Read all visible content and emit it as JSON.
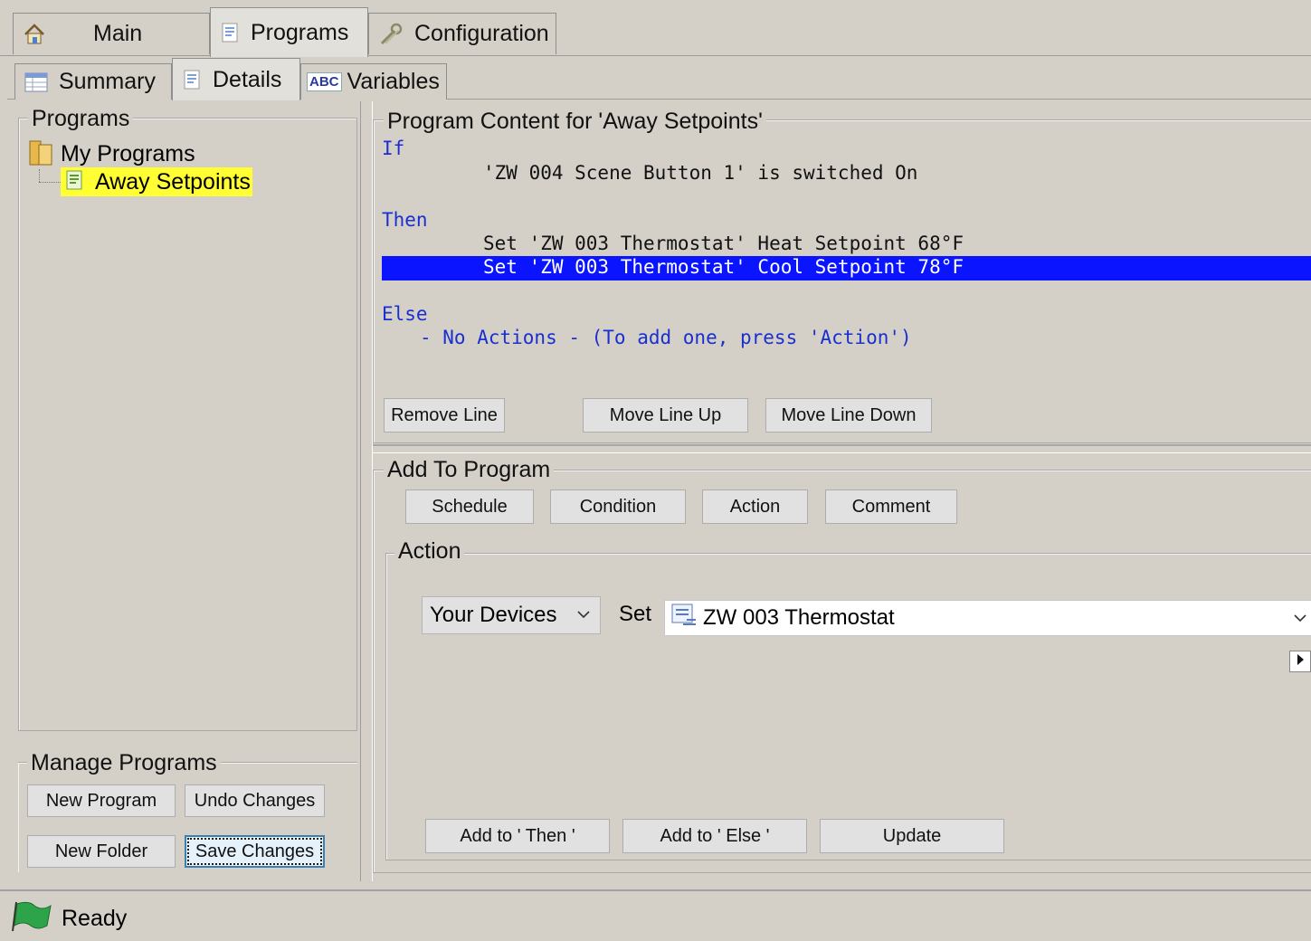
{
  "tabs_top": [
    {
      "label": "Main",
      "icon": "home-icon"
    },
    {
      "label": "Programs",
      "icon": "program-icon"
    },
    {
      "label": "Configuration",
      "icon": "wrench-icon"
    }
  ],
  "tabs_sub": [
    {
      "label": "Summary",
      "icon": "table-icon"
    },
    {
      "label": "Details",
      "icon": "program-icon"
    },
    {
      "label": "Variables",
      "icon": "abc-icon",
      "icon_text": "ABC"
    }
  ],
  "tree": {
    "title": "Programs",
    "folder": "My Programs",
    "program": "Away Setpoints"
  },
  "manage": {
    "title": "Manage Programs",
    "new_program": "New Program",
    "undo_changes": "Undo Changes",
    "new_folder": "New Folder",
    "save_changes": "Save Changes"
  },
  "content": {
    "title": "Program Content for 'Away Setpoints'",
    "if_kw": "If",
    "if_line": "'ZW 004 Scene Button 1' is switched On",
    "then_kw": "Then",
    "then_line1": "Set 'ZW 003 Thermostat' Heat Setpoint 68°F",
    "then_line2": "Set 'ZW 003 Thermostat' Cool Setpoint 78°F",
    "else_kw": "Else",
    "else_line": "- No Actions - (To add one, press 'Action')",
    "remove_line": "Remove Line",
    "move_up": "Move Line Up",
    "move_down": "Move Line Down"
  },
  "add": {
    "title": "Add To Program",
    "schedule": "Schedule",
    "condition": "Condition",
    "action": "Action",
    "comment": "Comment",
    "action_group": "Action",
    "source_select": "Your Devices",
    "set_label": "Set",
    "device_select": "ZW 003 Thermostat",
    "add_then": "Add to ' Then '",
    "add_else": "Add to ' Else '",
    "update": "Update"
  },
  "status": {
    "text": "Ready"
  },
  "colors": {
    "selection_blue": "#0a14ff",
    "keyword_blue": "#1a2fd0",
    "tree_highlight": "#ffff33",
    "window_bg": "#d4d0c8"
  }
}
